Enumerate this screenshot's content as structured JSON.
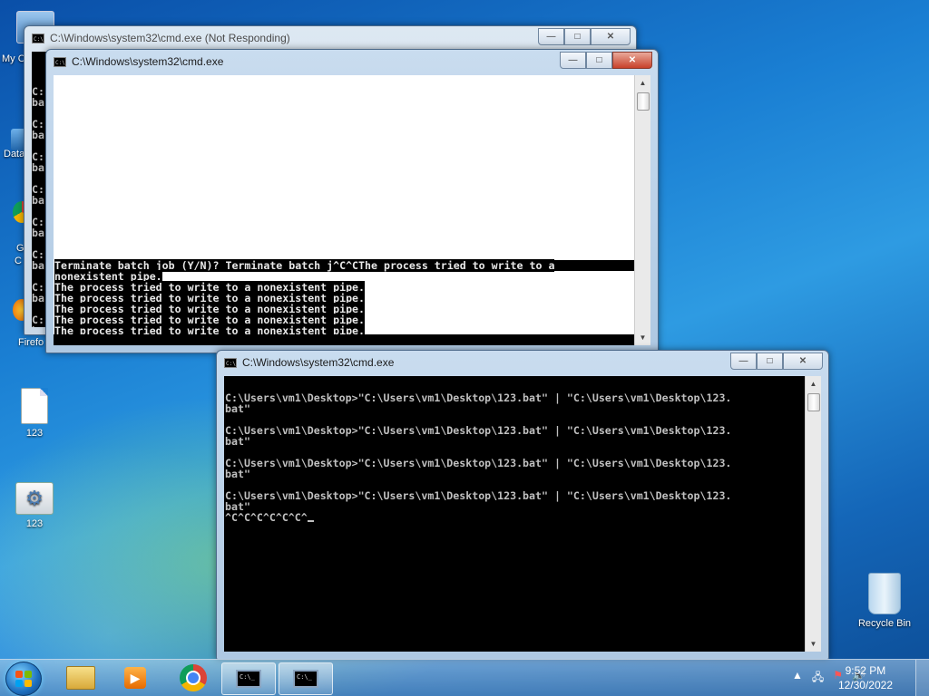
{
  "desktop": {
    "partial_labels": [
      "My C",
      "Data",
      "G",
      "C",
      "Firefo"
    ],
    "icons": [
      {
        "label": "123",
        "type": "text-file"
      },
      {
        "label": "123",
        "type": "batch-file"
      },
      {
        "label": "Recycle Bin",
        "type": "recycle-bin"
      }
    ]
  },
  "windows": {
    "back": {
      "title": "C:\\Windows\\system32\\cmd.exe (Not Responding)",
      "peek_lines": [
        "C:",
        "ba",
        "C:",
        "ba",
        "C:",
        "ba",
        "C:",
        "ba",
        "C:",
        "ba",
        "C:",
        "ba",
        "C:",
        "ba",
        "C:",
        "ba"
      ]
    },
    "middle": {
      "title": "C:\\Windows\\system32\\cmd.exe",
      "lines": [
        "Terminate batch job (Y/N)? Terminate batch j^C^CThe process tried to write to a",
        "nonexistent pipe.",
        "The process tried to write to a nonexistent pipe.",
        "The process tried to write to a nonexistent pipe.",
        "The process tried to write to a nonexistent pipe.",
        "The process tried to write to a nonexistent pipe.",
        "The process tried to write to a nonexistent pipe."
      ]
    },
    "front": {
      "title": "C:\\Windows\\system32\\cmd.exe",
      "lines": [
        "",
        "C:\\Users\\vm1\\Desktop>\"C:\\Users\\vm1\\Desktop\\123.bat\" | \"C:\\Users\\vm1\\Desktop\\123.",
        "bat\"",
        "",
        "C:\\Users\\vm1\\Desktop>\"C:\\Users\\vm1\\Desktop\\123.bat\" | \"C:\\Users\\vm1\\Desktop\\123.",
        "bat\"",
        "",
        "C:\\Users\\vm1\\Desktop>\"C:\\Users\\vm1\\Desktop\\123.bat\" | \"C:\\Users\\vm1\\Desktop\\123.",
        "bat\"",
        "",
        "C:\\Users\\vm1\\Desktop>\"C:\\Users\\vm1\\Desktop\\123.bat\" | \"C:\\Users\\vm1\\Desktop\\123.",
        "bat\""
      ],
      "prompt_line": "^C^C^C^C^C^C^"
    }
  },
  "taskbar": {
    "pinned": [
      "explorer-icon",
      "media-player-icon",
      "chrome-icon",
      "cmd-icon",
      "cmd-icon"
    ],
    "clock_time": "9:52 PM",
    "clock_date": "12/30/2022"
  }
}
